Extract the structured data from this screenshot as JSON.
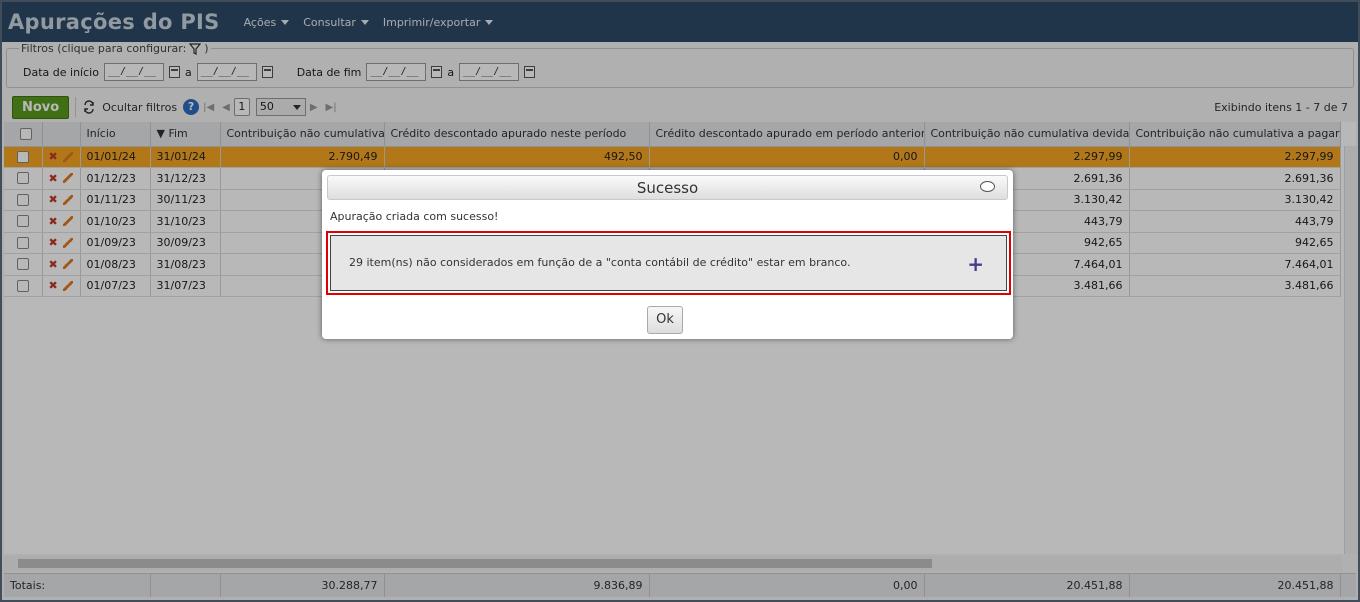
{
  "app": {
    "title": "Apurações do PIS",
    "menu": [
      "Ações",
      "Consultar",
      "Imprimir/exportar"
    ]
  },
  "filters": {
    "legend": "Filtros (clique para configurar:",
    "legend_close": ")",
    "data_inicio_label": "Data de início",
    "data_fim_label": "Data de fim",
    "sep": "a",
    "date_placeholder": "__/__/__"
  },
  "toolbar": {
    "novo": "Novo",
    "ocultar_filtros": "Ocultar filtros",
    "page": "1",
    "page_size": "50",
    "showing": "Exibindo itens 1 - 7 de 7"
  },
  "columns": {
    "inicio": "Início",
    "fim": "Fim",
    "c1": "Contribuição não cumulativa",
    "c2": "Crédito descontado apurado neste período",
    "c3": "Crédito descontado apurado em período anterior",
    "c4": "Contribuição não cumulativa devida",
    "c5": "Contribuição não cumulativa a pagar"
  },
  "rows": [
    {
      "inicio": "01/01/24",
      "fim": "31/01/24",
      "c1": "2.790,49",
      "c2": "492,50",
      "c3": "0,00",
      "c4": "2.297,99",
      "c5": "2.297,99"
    },
    {
      "inicio": "01/12/23",
      "fim": "31/12/23",
      "c1": "",
      "c2": "",
      "c3": "",
      "c4": "2.691,36",
      "c5": "2.691,36"
    },
    {
      "inicio": "01/11/23",
      "fim": "30/11/23",
      "c1": "",
      "c2": "",
      "c3": "",
      "c4": "3.130,42",
      "c5": "3.130,42"
    },
    {
      "inicio": "01/10/23",
      "fim": "31/10/23",
      "c1": "",
      "c2": "",
      "c3": "",
      "c4": "443,79",
      "c5": "443,79"
    },
    {
      "inicio": "01/09/23",
      "fim": "30/09/23",
      "c1": "",
      "c2": "",
      "c3": "",
      "c4": "942,65",
      "c5": "942,65"
    },
    {
      "inicio": "01/08/23",
      "fim": "31/08/23",
      "c1": "",
      "c2": "",
      "c3": "",
      "c4": "7.464,01",
      "c5": "7.464,01"
    },
    {
      "inicio": "01/07/23",
      "fim": "31/07/23",
      "c1": "",
      "c2": "",
      "c3": "",
      "c4": "3.481,66",
      "c5": "3.481,66"
    }
  ],
  "totals": {
    "label": "Totais:",
    "c1": "30.288,77",
    "c2": "9.836,89",
    "c3": "0,00",
    "c4": "20.451,88",
    "c5": "20.451,88"
  },
  "dialog": {
    "title": "Sucesso",
    "message": "Apuração criada com sucesso!",
    "detail": "29 item(ns) não considerados em função de a \"conta contábil de crédito\" estar em branco.",
    "ok": "Ok"
  },
  "colors": {
    "header_bg": "#2f4a67",
    "selected_row": "#f5a623",
    "novo_button": "#5a9a1e",
    "highlight_border": "#e00000"
  }
}
